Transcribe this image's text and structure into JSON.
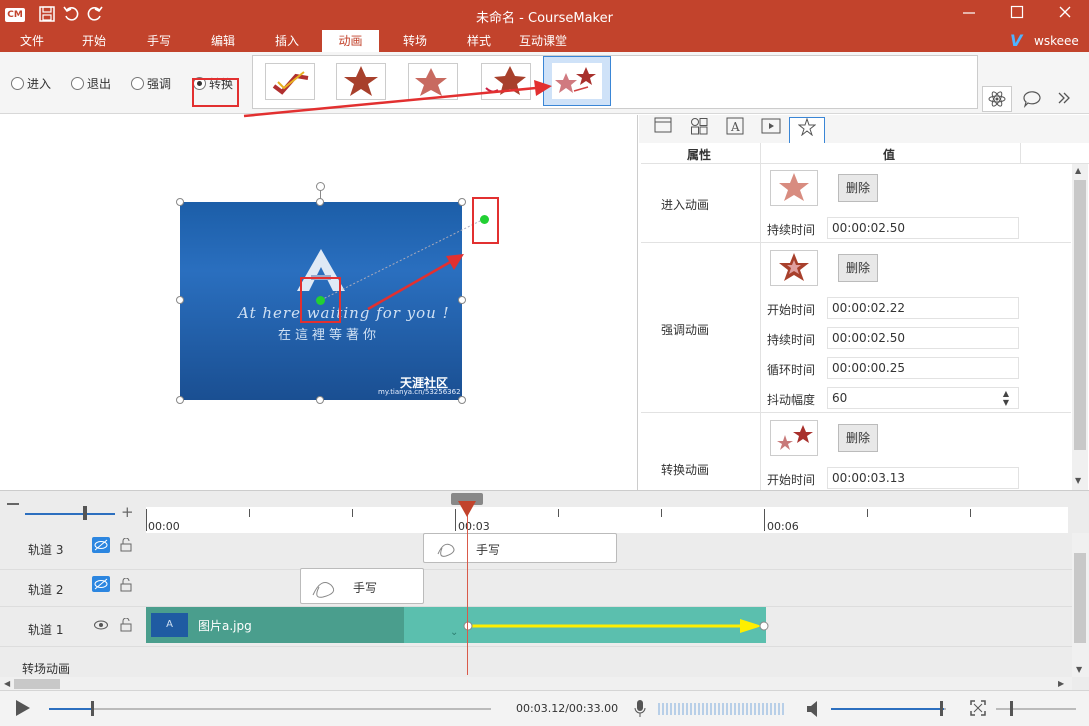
{
  "titlebar": {
    "app_logo": "CM",
    "title": "未命名 - CourseMaker",
    "icons": [
      "save-icon",
      "undo-icon",
      "redo-icon"
    ],
    "window_controls": [
      "minimize-icon",
      "maximize-icon",
      "close-icon"
    ]
  },
  "menu": {
    "items": [
      "文件",
      "开始",
      "手写",
      "编辑",
      "插入",
      "动画",
      "转场",
      "样式",
      "互动课堂"
    ],
    "active": "动画",
    "user_logo": "V",
    "username": "wskeee"
  },
  "ribbon": {
    "radios": [
      {
        "label": "进入",
        "checked": false
      },
      {
        "label": "退出",
        "checked": false
      },
      {
        "label": "强调",
        "checked": false
      },
      {
        "label": "转换",
        "checked": true
      }
    ],
    "right_icons": [
      "atom-icon",
      "comment-icon",
      "chevrons-right-icon"
    ]
  },
  "canvas": {
    "image_line1": "At here waiting for you !",
    "image_line2": "在這裡等著你",
    "watermark": "天涯社区",
    "watermark_url": "my.tianya.cn/53256362"
  },
  "properties": {
    "col_attr": "属性",
    "col_value": "值",
    "delete_label": "删除",
    "enter": {
      "label": "进入动画",
      "duration_label": "持续时间",
      "duration": "00:00:02.50"
    },
    "emphasis": {
      "label": "强调动画",
      "start_label": "开始时间",
      "start": "00:00:02.22",
      "duration_label": "持续时间",
      "duration": "00:00:02.50",
      "loop_label": "循环时间",
      "loop": "00:00:00.25",
      "shake_label": "抖动幅度",
      "shake": "60"
    },
    "transform": {
      "label": "转换动画",
      "start_label": "开始时间",
      "start": "00:00:03.13"
    }
  },
  "timeline": {
    "ruler": [
      "00:00",
      "00:03",
      "00:06"
    ],
    "tracks": [
      {
        "label": "轨道 3",
        "clip": "手写"
      },
      {
        "label": "轨道 2",
        "clip": "手写"
      },
      {
        "label": "轨道 1",
        "clip": "图片a.jpg"
      },
      {
        "label": "转场动画",
        "clip": ""
      }
    ],
    "playhead_fraction": 0.52
  },
  "player": {
    "time": "00:03.12/00:33.00",
    "progress_fraction": 0.094,
    "volume_fraction": 0.98
  },
  "colors": {
    "brand": "#c2432c",
    "selection_blue": "#3a86d6",
    "annotation_red": "#e23030",
    "clip_green": "#5bbfae",
    "arrow_yellow": "#ffee00"
  }
}
